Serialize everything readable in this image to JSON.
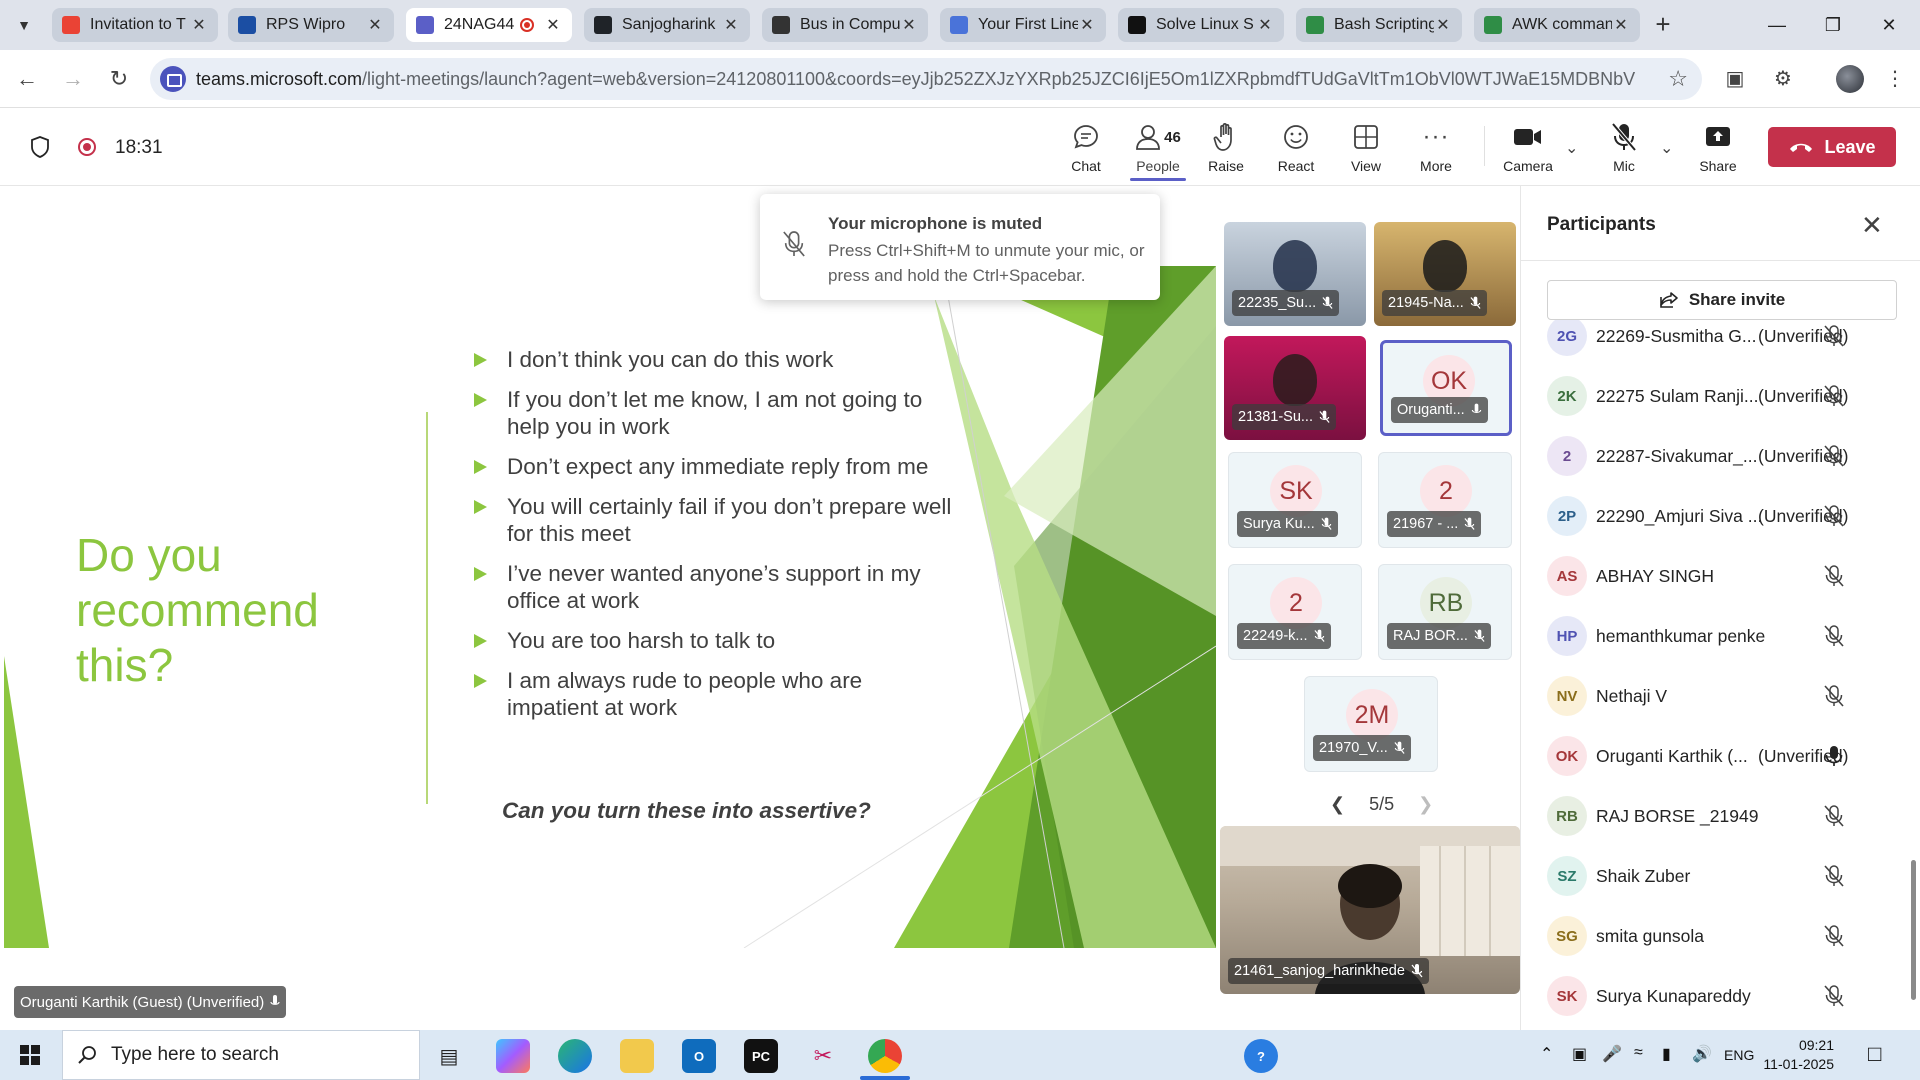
{
  "browser": {
    "tabs": [
      {
        "label": "Invitation to T",
        "icon": "gmail-icon",
        "color": "#ea4335"
      },
      {
        "label": "RPS Wipro",
        "icon": "nit-icon",
        "color": "#1b4ea3"
      },
      {
        "label": "24NAG44",
        "icon": "teams-icon",
        "color": "#5b5fc7",
        "active": true
      },
      {
        "label": "Sanjogharink",
        "icon": "github-icon",
        "color": "#1f2328"
      },
      {
        "label": "Bus in Compu",
        "icon": "openai-icon",
        "color": "#333"
      },
      {
        "label": "Your First Line",
        "icon": "flask-icon",
        "color": "#4a73d9"
      },
      {
        "label": "Solve Linux S",
        "icon": "hackerrank-icon",
        "color": "#111"
      },
      {
        "label": "Bash Scripting",
        "icon": "gfg-icon",
        "color": "#2f8d46"
      },
      {
        "label": "AWK comman",
        "icon": "gfg-icon",
        "color": "#2f8d46"
      }
    ],
    "url": "teams.microsoft.com",
    "url_rest": "/light-meetings/launch?agent=web&version=24120801100&coords=eyJjb252ZXJzYXRpb25JZCI6IjE5Om1lZXRpbmdfTUdGaVltTm1ObVl0WTJWaE15MDBNbVl4TFRsa..."
  },
  "meeting": {
    "timer": "18:31",
    "controls": {
      "chat": "Chat",
      "people": "People",
      "people_count": "46",
      "raise": "Raise",
      "react": "React",
      "view": "View",
      "more": "More",
      "camera": "Camera",
      "mic": "Mic",
      "share": "Share",
      "leave": "Leave"
    }
  },
  "slide": {
    "title": "Do you recommend this?",
    "bullets": [
      "I don’t think you can do this work",
      "If you don’t let me know, I am not going to help you in work",
      "Don’t expect any immediate reply from me",
      "You will certainly fail if you don’t prepare well for this meet",
      "I’ve never wanted anyone’s support in my office at work",
      "You are too harsh to talk to",
      "I am always rude to people who are impatient at work"
    ],
    "question": "Can you turn these into assertive?"
  },
  "toast": {
    "title": "Your microphone is muted",
    "body": "Press Ctrl+Shift+M to unmute your mic, or press and hold the Ctrl+Spacebar."
  },
  "self_tag": "Oruganti Karthik (Guest) (Unverified)",
  "gallery": {
    "tiles": [
      {
        "name": "22235_Su...",
        "initials": ""
      },
      {
        "name": "21945-Na...",
        "initials": ""
      },
      {
        "name": "21381-Su...",
        "initials": ""
      },
      {
        "name": "Oruganti...",
        "initials": "OK"
      },
      {
        "name": "Surya Ku...",
        "initials": "SK"
      },
      {
        "name": "21967 - ...",
        "initials": "2"
      },
      {
        "name": "22249-k...",
        "initials": "2"
      },
      {
        "name": "RAJ BOR...",
        "initials": "RB"
      },
      {
        "name": "21970_V...",
        "initials": "2M"
      }
    ],
    "page": "5/5",
    "spotlight_name": "21461_sanjog_harinkhede"
  },
  "panel": {
    "title": "Participants",
    "invite": "Share invite",
    "participants": [
      {
        "initials": "2G",
        "name": "22269-Susmitha G...",
        "status": "(Unverified)",
        "mic": "muted",
        "bg": "#e6e8f7",
        "fg": "#4f52b2"
      },
      {
        "initials": "2K",
        "name": "22275 Sulam Ranji...",
        "status": "(Unverified)",
        "mic": "muted",
        "bg": "#e5f1e6",
        "fg": "#3b6f3e"
      },
      {
        "initials": "2",
        "name": "22287-Sivakumar_...",
        "status": "(Unverified)",
        "mic": "muted",
        "bg": "#ede6f5",
        "fg": "#6b4b91"
      },
      {
        "initials": "2P",
        "name": "22290_Amjuri Siva ...",
        "status": "(Unverified)",
        "mic": "muted",
        "bg": "#e3eef8",
        "fg": "#2c5f8a"
      },
      {
        "initials": "AS",
        "name": "ABHAY SINGH",
        "status": "",
        "mic": "muted",
        "bg": "#fbe5e8",
        "fg": "#a4373a"
      },
      {
        "initials": "HP",
        "name": "hemanthkumar penke",
        "status": "",
        "mic": "muted",
        "bg": "#e6e8f7",
        "fg": "#4f52b2"
      },
      {
        "initials": "NV",
        "name": "Nethaji V",
        "status": "",
        "mic": "muted",
        "bg": "#fbf1d9",
        "fg": "#8a6d1b"
      },
      {
        "initials": "OK",
        "name": "Oruganti Karthik (...",
        "status": "(Unverified)",
        "mic": "on",
        "bg": "#fbe5e8",
        "fg": "#a4373a"
      },
      {
        "initials": "RB",
        "name": "RAJ BORSE _21949",
        "status": "",
        "mic": "muted",
        "bg": "#e8efe3",
        "fg": "#4f6b3a"
      },
      {
        "initials": "SZ",
        "name": "Shaik Zuber",
        "status": "",
        "mic": "muted",
        "bg": "#e1f3ef",
        "fg": "#2b7a6a"
      },
      {
        "initials": "SG",
        "name": "smita gunsola",
        "status": "",
        "mic": "muted",
        "bg": "#fbf1d9",
        "fg": "#8a6d1b"
      },
      {
        "initials": "SK",
        "name": "Surya Kunapareddy",
        "status": "",
        "mic": "muted",
        "bg": "#fbe5e8",
        "fg": "#a4373a"
      }
    ]
  },
  "taskbar": {
    "search_placeholder": "Type here to search",
    "lang": "ENG",
    "time": "09:21",
    "date": "11-01-2025"
  }
}
